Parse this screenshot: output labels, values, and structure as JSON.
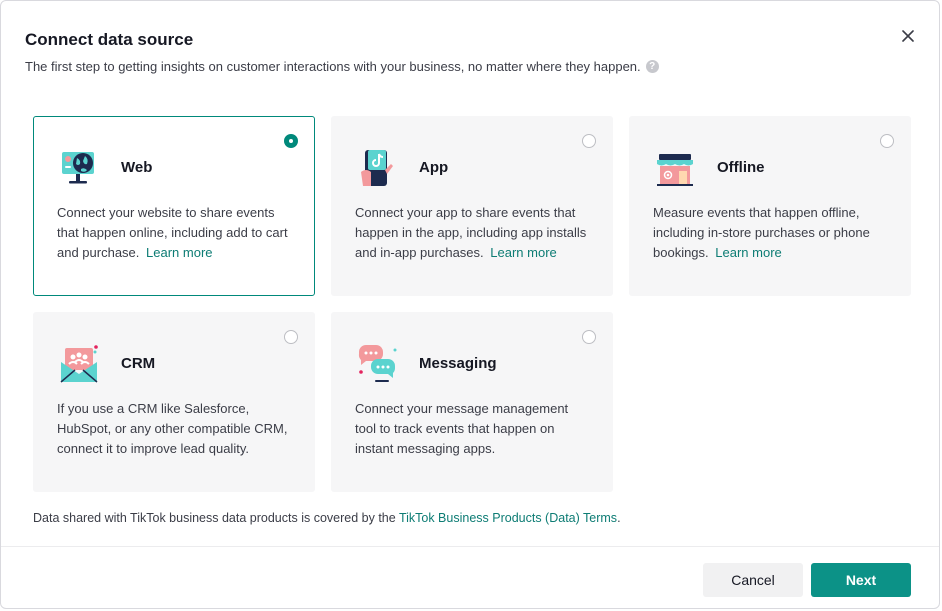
{
  "dialog": {
    "title": "Connect data source",
    "subtitle": "The first step to getting insights on customer interactions with your business, no matter where they happen.",
    "help_glyph": "?"
  },
  "cards": [
    {
      "key": "web",
      "title": "Web",
      "description": "Connect your website to share events that happen online, including add to cart and purchase.",
      "link": "Learn more",
      "selected": true,
      "icon": "globe-monitor-icon"
    },
    {
      "key": "app",
      "title": "App",
      "description": "Connect your app to share events that happen in the app, including app installs and in-app purchases.",
      "link": "Learn more",
      "selected": false,
      "icon": "phone-app-icon"
    },
    {
      "key": "offline",
      "title": "Offline",
      "description": "Measure events that happen offline, including in-store purchases or phone bookings.",
      "link": "Learn more",
      "selected": false,
      "icon": "store-icon"
    },
    {
      "key": "crm",
      "title": "CRM",
      "description": "If you use a CRM like Salesforce, HubSpot, or any other compatible CRM, connect it to improve lead quality.",
      "link": "",
      "selected": false,
      "icon": "crm-envelope-icon"
    },
    {
      "key": "messaging",
      "title": "Messaging",
      "description": "Connect your message management tool to track events that happen on instant messaging apps.",
      "link": "",
      "selected": false,
      "icon": "chat-bubbles-icon"
    }
  ],
  "terms": {
    "prefix": "Data shared with TikTok business data products is covered by the ",
    "link": "TikTok Business Products (Data) Terms",
    "suffix": "."
  },
  "footer": {
    "cancel_label": "Cancel",
    "next_label": "Next"
  },
  "colors": {
    "accent": "#0c9287",
    "link": "#0d7c74",
    "card_bg": "#f6f6f7"
  }
}
